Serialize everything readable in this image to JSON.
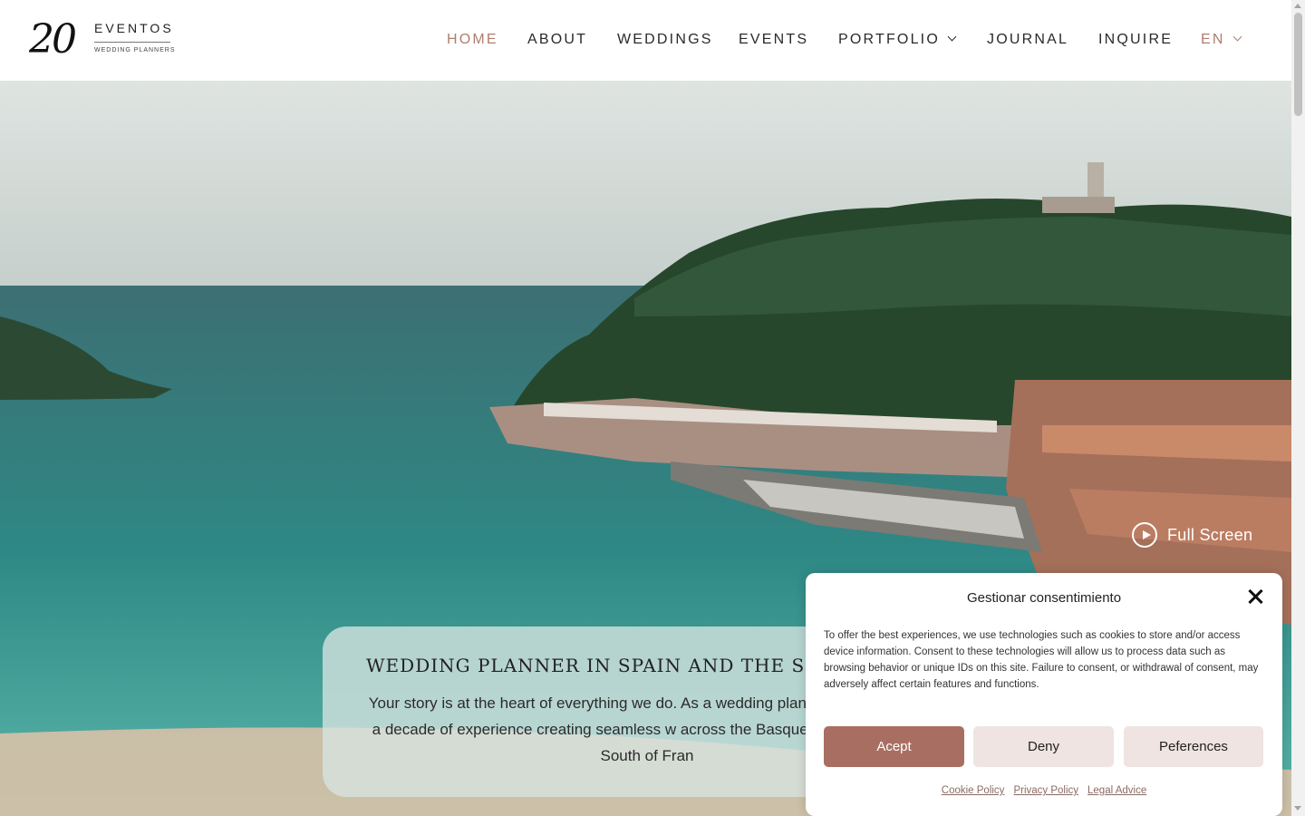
{
  "logo": {
    "number": "20",
    "word": "EVENTOS",
    "sub": "WEDDING PLANNERS"
  },
  "nav": {
    "items": [
      {
        "label": "HOME"
      },
      {
        "label": "ABOUT"
      },
      {
        "label": "WEDDINGS"
      },
      {
        "label": "EVENTS"
      },
      {
        "label": "PORTFOLIO"
      },
      {
        "label": "JOURNAL"
      },
      {
        "label": "INQUIRE"
      },
      {
        "label": "EN"
      }
    ]
  },
  "hero": {
    "fullscreen_label": "Full Screen",
    "title": "WEDDING PLANNER IN SPAIN AND THE SOUTH",
    "text": "Your story is at the heart of everything we do. As a wedding plan team brings over a decade of experience creating seamless w across the Basque Country and the South of Fran"
  },
  "consent": {
    "title": "Gestionar consentimiento",
    "body": "To offer the best experiences, we use technologies such as cookies to store and/or access device information. Consent to these technologies will allow us to process data such as browsing behavior or unique IDs on this site. Failure to consent, or withdrawal of consent, may adversely affect certain features and functions.",
    "accept": "Acept",
    "deny": "Deny",
    "preferences": "Peferences",
    "links": [
      "Cookie Policy",
      "Privacy Policy",
      "Legal Advice"
    ]
  },
  "colors": {
    "accent": "#b07d6e",
    "accept_button": "#a96e62",
    "secondary_button": "#efe4e1"
  }
}
